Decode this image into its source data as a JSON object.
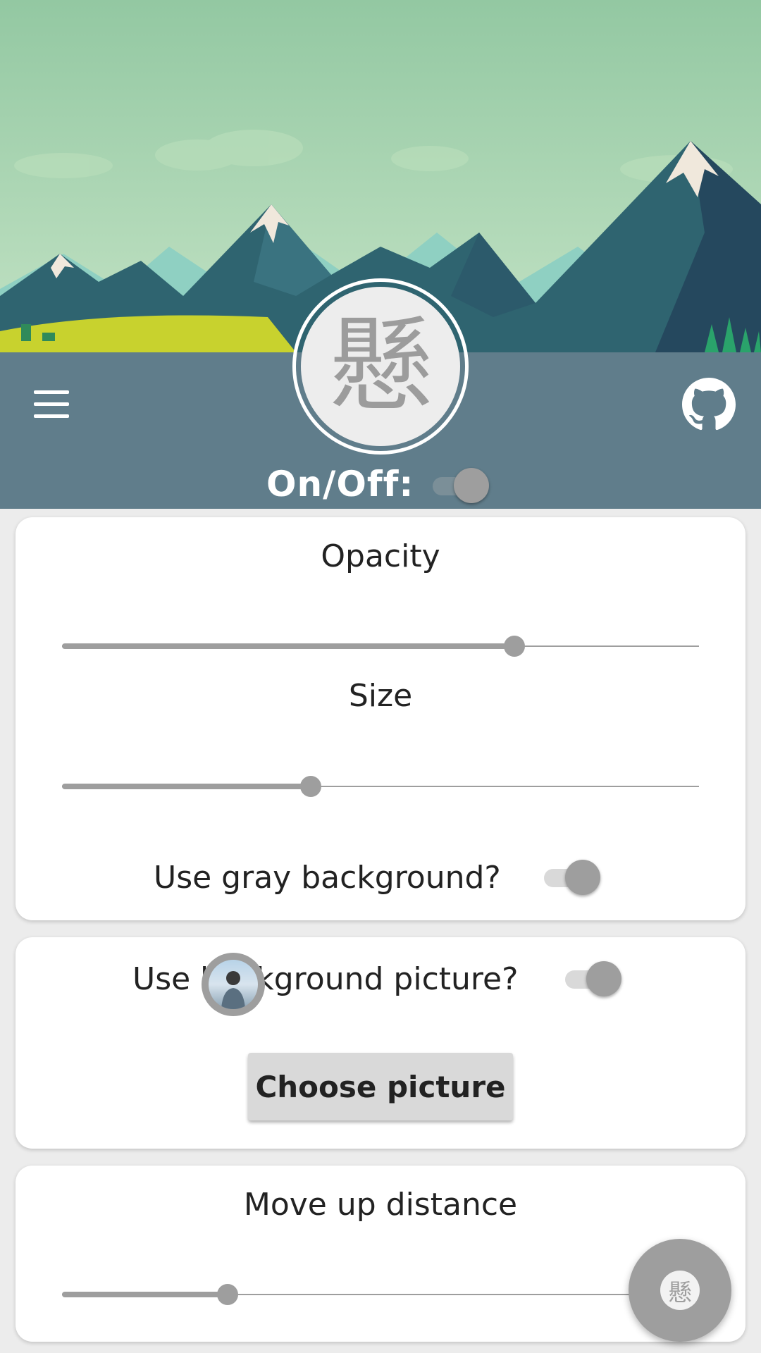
{
  "header": {
    "logo_glyph": "懸",
    "onoff_label": "On/Off:",
    "onoff_state": false,
    "band_color": "#607d8b"
  },
  "card_display": {
    "opacity_title": "Opacity",
    "opacity_value": 0.71,
    "size_title": "Size",
    "size_value": 0.39,
    "gray_bg_label": "Use gray background?",
    "gray_bg_state": false
  },
  "card_picture": {
    "bg_picture_label": "Use background picture?",
    "bg_picture_state": false,
    "choose_button": "Choose picture"
  },
  "card_move": {
    "move_title": "Move up distance",
    "move_value": 0.26
  },
  "floating_button": {
    "glyph": "懸"
  },
  "icons": {
    "menu": "hamburger-menu-icon",
    "github": "github-icon"
  }
}
